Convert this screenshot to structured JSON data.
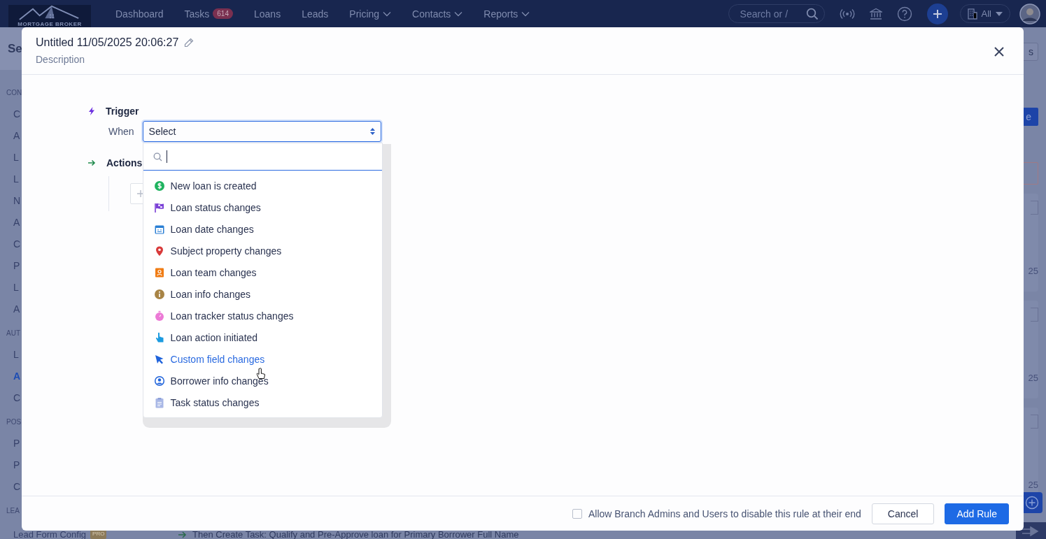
{
  "nav": {
    "logo_text": "MORTGAGE BROKER",
    "items": [
      {
        "label": "Dashboard",
        "kind": "link"
      },
      {
        "label": "Tasks",
        "kind": "badge",
        "badge": "614"
      },
      {
        "label": "Loans",
        "kind": "link"
      },
      {
        "label": "Leads",
        "kind": "link"
      },
      {
        "label": "Pricing",
        "kind": "menu"
      },
      {
        "label": "Contacts",
        "kind": "menu"
      },
      {
        "label": "Reports",
        "kind": "menu"
      }
    ],
    "search": {
      "placeholder": "Search or /"
    },
    "org_filter": "All"
  },
  "sidebar": {
    "title": "Se",
    "sections": [
      {
        "heading": "CON",
        "items": [
          {
            "label": "C",
            "selected": false
          },
          {
            "label": "A",
            "selected": false
          },
          {
            "label": "L",
            "selected": false
          },
          {
            "label": "L",
            "selected": false
          },
          {
            "label": "N",
            "selected": false
          },
          {
            "label": "A",
            "selected": false
          },
          {
            "label": "C",
            "selected": false
          },
          {
            "label": "P",
            "selected": false
          },
          {
            "label": "L",
            "selected": false
          },
          {
            "label": "A",
            "selected": false
          }
        ]
      },
      {
        "heading": "AUT",
        "items": [
          {
            "label": "L",
            "selected": false
          },
          {
            "label": "A",
            "selected": true
          },
          {
            "label": "C",
            "selected": false
          }
        ]
      },
      {
        "heading": "POS",
        "items": [
          {
            "label": "P",
            "selected": false
          },
          {
            "label": "P",
            "selected": false
          },
          {
            "label": "C",
            "selected": false
          }
        ]
      },
      {
        "heading": "LEA",
        "items": [
          {
            "label": "Lead Form Config",
            "selected": false,
            "badge": "PRO"
          }
        ]
      }
    ]
  },
  "background": {
    "top_button": "s",
    "primary_button": "e",
    "dates": [
      "25",
      "25",
      "25"
    ],
    "rule_text": "Then Create Task: Qualify and Pre-Approve loan for Primary Borrower Full Name"
  },
  "modal": {
    "title": "Untitled 11/05/2025 20:06:27",
    "description": "Description",
    "trigger": {
      "heading": "Trigger",
      "when_label": "When",
      "select_value": "Select",
      "dropdown": {
        "options": [
          {
            "label": "New loan is created",
            "selected": false
          },
          {
            "label": "Loan status changes",
            "selected": false
          },
          {
            "label": "Loan date changes",
            "selected": false
          },
          {
            "label": "Subject property changes",
            "selected": false
          },
          {
            "label": "Loan team changes",
            "selected": false
          },
          {
            "label": "Loan info changes",
            "selected": false
          },
          {
            "label": "Loan tracker status changes",
            "selected": false
          },
          {
            "label": "Loan action initiated",
            "selected": false
          },
          {
            "label": "Custom field changes",
            "selected": true
          },
          {
            "label": "Borrower info changes",
            "selected": false
          },
          {
            "label": "Task status changes",
            "selected": false
          }
        ]
      }
    },
    "actions": {
      "heading": "Actions"
    },
    "footer": {
      "allow_disable": {
        "label": "Allow Branch Admins and Users to disable this rule at their end",
        "checked": false
      },
      "buttons": [
        {
          "label": "Cancel",
          "kind": "secondary"
        },
        {
          "label": "Add Rule",
          "kind": "primary"
        }
      ]
    }
  }
}
